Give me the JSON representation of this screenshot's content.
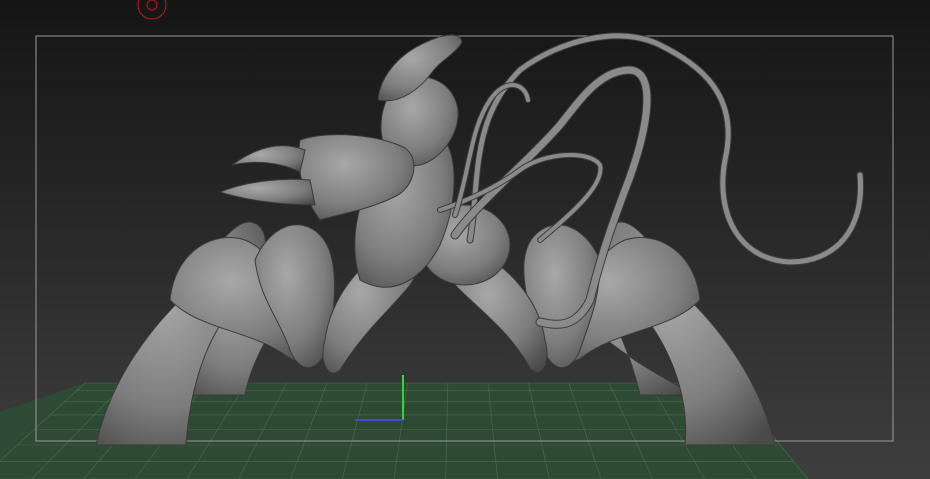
{
  "viewport": {
    "background_top": "#151515",
    "background_bottom": "#3e3e3e",
    "frame_color": "#9a9a9a",
    "floor_color": "#2f4a34",
    "floor_line_color": "#5f8a64",
    "axis_y_color": "#3ad13a",
    "axis_x_color": "#3a4cd1",
    "nav_cursor_color": "#c21818",
    "model_fill": "#7d7d7d",
    "model_shadow": "#4a4a4a"
  },
  "icons": {
    "nav": "rotation-gizmo-icon",
    "axis": "axis-gizmo-icon"
  }
}
